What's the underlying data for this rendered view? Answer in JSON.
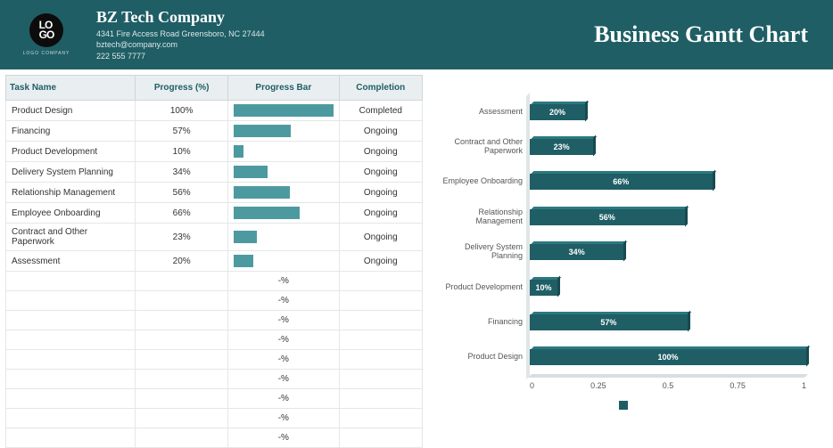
{
  "header": {
    "logo_text": "LO\nGO",
    "logo_caption": "LOGO COMPANY",
    "company_name": "BZ Tech Company",
    "address": "4341 Fire Access Road Greensboro, NC 27444",
    "email": "bztech@company.com",
    "phone": "222 555 7777",
    "title": "Business Gantt Chart"
  },
  "table": {
    "columns": [
      "Task Name",
      "Progress (%)",
      "Progress Bar",
      "Completion"
    ],
    "rows": [
      {
        "name": "Product Design",
        "progress": "100%",
        "bar": 100,
        "status": "Completed"
      },
      {
        "name": "Financing",
        "progress": "57%",
        "bar": 57,
        "status": "Ongoing"
      },
      {
        "name": "Product Development",
        "progress": "10%",
        "bar": 10,
        "status": "Ongoing"
      },
      {
        "name": "Delivery System Planning",
        "progress": "34%",
        "bar": 34,
        "status": "Ongoing"
      },
      {
        "name": "Relationship Management",
        "progress": "56%",
        "bar": 56,
        "status": "Ongoing"
      },
      {
        "name": "Employee Onboarding",
        "progress": "66%",
        "bar": 66,
        "status": "Ongoing"
      },
      {
        "name": "Contract and Other Paperwork",
        "progress": "23%",
        "bar": 23,
        "status": "Ongoing"
      },
      {
        "name": "Assessment",
        "progress": "20%",
        "bar": 20,
        "status": "Ongoing"
      }
    ],
    "empty_rows": 9,
    "empty_text": "-%"
  },
  "chart_data": {
    "type": "bar",
    "orientation": "horizontal",
    "xlabel": "",
    "ylabel": "",
    "xlim": [
      0,
      1
    ],
    "ticks": [
      "0",
      "0.25",
      "0.5",
      "0.75",
      "1"
    ],
    "categories": [
      "Assessment",
      "Contract and Other Paperwork",
      "Employee Onboarding",
      "Relationship Management",
      "Delivery System Planning",
      "Product Development",
      "Financing",
      "Product Design"
    ],
    "values": [
      0.2,
      0.23,
      0.66,
      0.56,
      0.34,
      0.1,
      0.57,
      1.0
    ],
    "value_labels": [
      "20%",
      "23%",
      "66%",
      "56%",
      "34%",
      "10%",
      "57%",
      "100%"
    ],
    "color": "#1f5e65"
  }
}
